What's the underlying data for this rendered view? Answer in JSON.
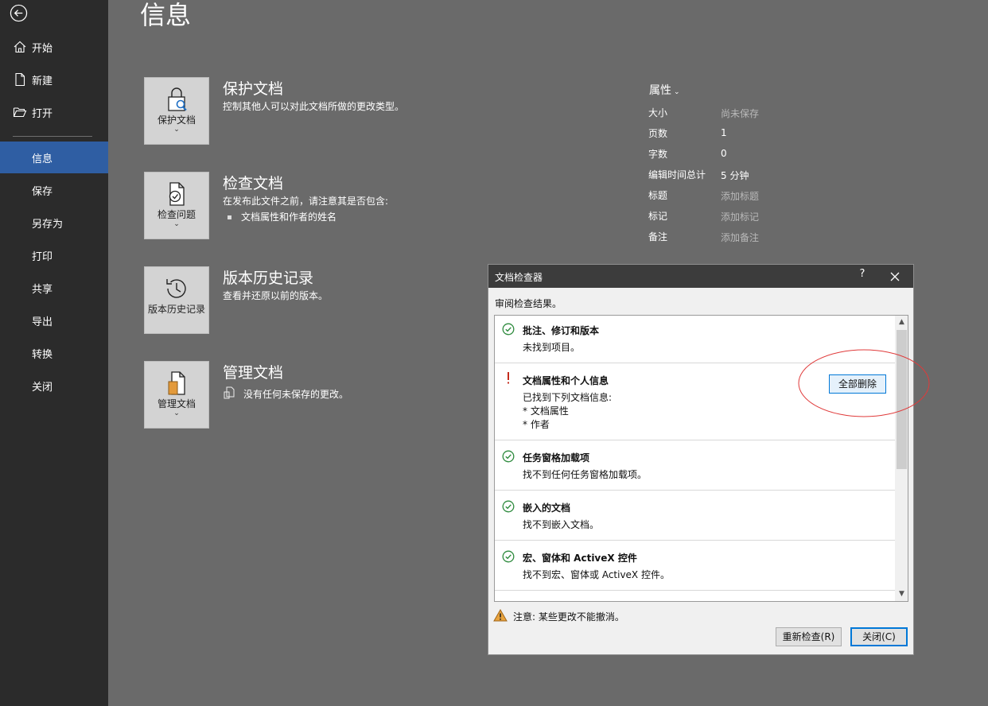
{
  "sidebar": {
    "back_icon": "back-arrow-icon",
    "items": [
      {
        "label": "开始",
        "icon": "home-icon"
      },
      {
        "label": "新建",
        "icon": "new-document-icon"
      },
      {
        "label": "打开",
        "icon": "open-folder-icon"
      },
      {
        "label": "信息"
      },
      {
        "label": "保存"
      },
      {
        "label": "另存为"
      },
      {
        "label": "打印"
      },
      {
        "label": "共享"
      },
      {
        "label": "导出"
      },
      {
        "label": "转换"
      },
      {
        "label": "关闭"
      }
    ],
    "active": "信息",
    "active_color": "#2f5ea3"
  },
  "page": {
    "title": "信息"
  },
  "sections": {
    "protect": {
      "button_label": "保护文档",
      "title": "保护文档",
      "desc": "控制其他人可以对此文档所做的更改类型。"
    },
    "inspect": {
      "button_label": "检查问题",
      "title": "检查文档",
      "desc": "在发布此文件之前，请注意其是否包含:",
      "bullet": "文档属性和作者的姓名"
    },
    "history": {
      "button_label": "版本历史记录",
      "title": "版本历史记录",
      "desc": "查看并还原以前的版本。"
    },
    "manage": {
      "button_label": "管理文档",
      "title": "管理文档",
      "desc": "没有任何未保存的更改。"
    }
  },
  "properties": {
    "title": "属性",
    "rows": [
      {
        "label": "大小",
        "value": "尚未保存",
        "muted": true
      },
      {
        "label": "页数",
        "value": "1",
        "muted": false
      },
      {
        "label": "字数",
        "value": "0",
        "muted": false
      },
      {
        "label": "编辑时间总计",
        "value": "5 分钟",
        "muted": false
      },
      {
        "label": "标题",
        "value": "添加标题",
        "muted": true
      },
      {
        "label": "标记",
        "value": "添加标记",
        "muted": true
      },
      {
        "label": "备注",
        "value": "添加备注",
        "muted": true
      }
    ]
  },
  "dialog": {
    "title": "文档检查器",
    "help": "?",
    "subtitle": "审阅检查结果。",
    "results": [
      {
        "status": "ok",
        "title": "批注、修订和版本",
        "lines": [
          "未找到项目。"
        ]
      },
      {
        "status": "warning",
        "title": "文档属性和个人信息",
        "lines": [
          "已找到下列文档信息:",
          "* 文档属性",
          "* 作者"
        ],
        "action": "全部删除"
      },
      {
        "status": "ok",
        "title": "任务窗格加载项",
        "lines": [
          "找不到任何任务窗格加载项。"
        ]
      },
      {
        "status": "ok",
        "title": "嵌入的文档",
        "lines": [
          "找不到嵌入文档。"
        ]
      },
      {
        "status": "ok",
        "title": "宏、窗体和 ActiveX 控件",
        "lines": [
          "找不到宏、窗体或 ActiveX 控件。"
        ]
      }
    ],
    "warning_note": "注意: 某些更改不能撤消。",
    "reinspect_label": "重新检查(R)",
    "close_label": "关闭(C)",
    "ok_color": "#2e8b3e",
    "warn_color": "#c42b1c",
    "accent_color": "#0078d7"
  }
}
